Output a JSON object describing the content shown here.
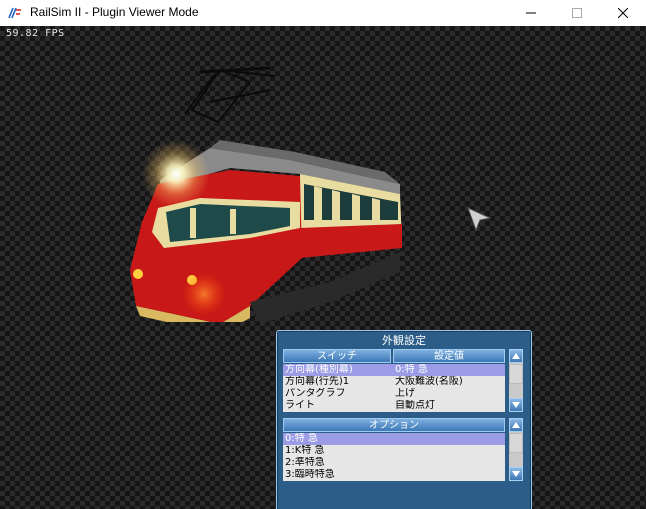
{
  "window": {
    "title": "RailSim II - Plugin Viewer Mode"
  },
  "viewport": {
    "fps_text": "59.82 FPS"
  },
  "panel": {
    "title": "外観設定",
    "switch_header": "スイッチ",
    "value_header": "設定値",
    "option_header": "オプション",
    "switch_rows": [
      {
        "name": "方向幕(種別幕)",
        "value": "0:特 急"
      },
      {
        "name": "方向幕(行先)1",
        "value": "大阪難波(名阪)"
      },
      {
        "name": "パンタグラフ",
        "value": "上げ"
      },
      {
        "name": "ライト",
        "value": "自動点灯"
      }
    ],
    "option_rows": [
      {
        "label": "0:特 急"
      },
      {
        "label": "1:K特 急"
      },
      {
        "label": "2:準特急"
      },
      {
        "label": "3:臨時特急"
      }
    ]
  },
  "colors": {
    "selected_row": "#9c9ce6",
    "panel_bg": "#2b5d88",
    "train_red": "#c81818"
  }
}
